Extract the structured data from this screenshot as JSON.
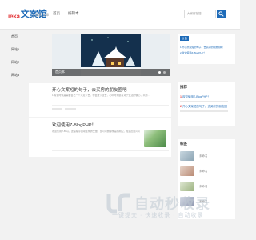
{
  "header": {
    "logo_mark": "ieka",
    "logo_text": "文案馆",
    "logo_sub": "文案网 文章",
    "nav": [
      "首页",
      "编辑本"
    ],
    "search_placeholder": "大家都在搜"
  },
  "left_nav": {
    "items": [
      "首页",
      "网站1",
      "网站2",
      "网站3"
    ]
  },
  "slider": {
    "caption": "首页本"
  },
  "articles": [
    {
      "title": "开心文案短的句子，去买房的朋友圈吧",
      "excerpt": "1.有些时候是需要自己一个人走下去，学会放下过去，心中时刻装有对于生活的信心，以前..."
    },
    {
      "title": "欢迎使用Z-BlogPHP！",
      "excerpt": "欢迎使用Z-Blog，这是程序自动生成的文章，您可以删除或是编辑它，在后台您可以用..."
    }
  ],
  "right": {
    "notice_tag": "公告",
    "notice_lines": [
      "1.开心文案短的句子，去买房的朋友圈吧",
      "2.欢迎使用Z-BlogPHP！"
    ],
    "recommend_head": "推荐",
    "recommend": [
      {
        "num": "1",
        "title": "欢迎使用Z-BlogPHP！"
      },
      {
        "num": "2",
        "title": "开心文案短的句子，去买房的朋友圈"
      }
    ],
    "tags_head": "标签",
    "tags": [
      "未命名",
      "未命名",
      "未命名",
      "未命名"
    ]
  },
  "watermark": {
    "main": "自动秒收录",
    "sub": "一键提交 · 快速收录 · 自动收录"
  }
}
